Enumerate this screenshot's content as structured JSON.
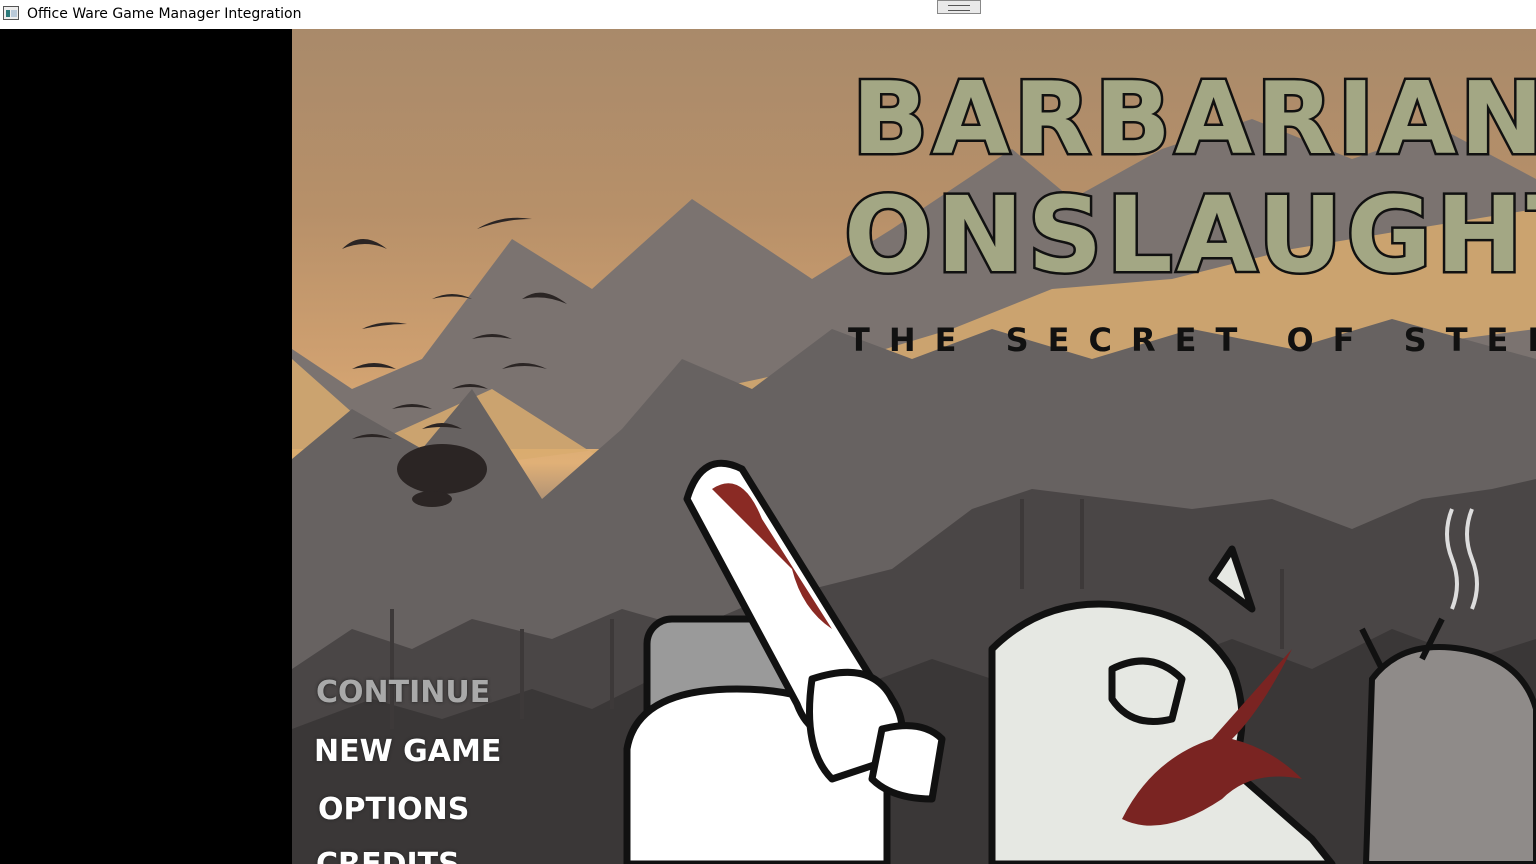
{
  "window": {
    "title": "Office Ware Game Manager Integration",
    "icon": "app-window-icon"
  },
  "game": {
    "logo_line1": "BARBARIAN",
    "logo_line2": "ONSLAUGHT",
    "subtitle": "THE SECRET OF STEEL",
    "menu": {
      "continue": "CONTINUE",
      "new_game": "NEW GAME",
      "options": "OPTIONS",
      "credits": "CREDITS"
    },
    "colors": {
      "sky": "#c69a6d",
      "mountains": "#6b6664",
      "logo_fill": "#a3a784",
      "menu_enabled": "#ffffff",
      "menu_disabled": "#a9a9a9",
      "blood": "#7a2422"
    }
  }
}
